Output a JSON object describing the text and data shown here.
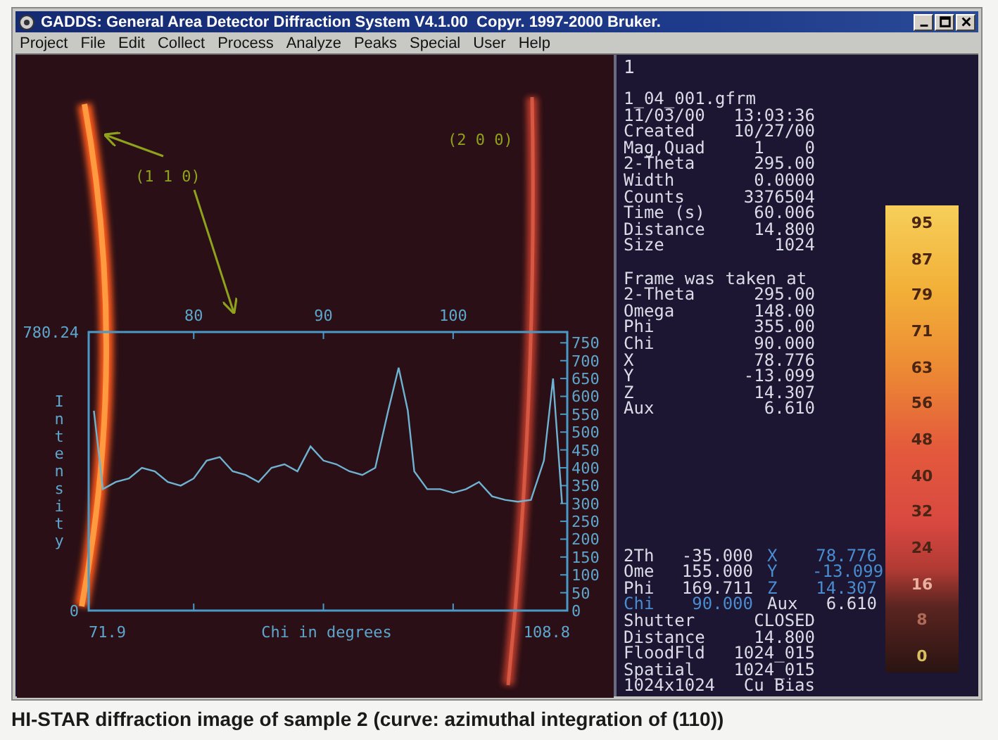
{
  "window": {
    "title": "GADDS: General Area Detector Diffraction System V4.1.00  Copyr. 1997-2000 Bruker."
  },
  "menu": [
    "Project",
    "File",
    "Edit",
    "Collect",
    "Process",
    "Analyze",
    "Peaks",
    "Special",
    "User",
    "Help"
  ],
  "image": {
    "annotations": [
      {
        "text": "(1 1 0)"
      },
      {
        "text": "(2 0 0)"
      }
    ],
    "axis_labels": {
      "y_max": "780.24",
      "y_min": "0",
      "x_min": "71.9",
      "x_max": "108.8"
    },
    "chart_data": {
      "type": "line",
      "xlabel": "Chi in degrees",
      "ylabel": "Intensity",
      "x": [
        72.3,
        73,
        74,
        75,
        76,
        77,
        78,
        79,
        80,
        81,
        82,
        83,
        84,
        85,
        86,
        87,
        88,
        89,
        90,
        91,
        92,
        93,
        94,
        95,
        95.8,
        96.5,
        97,
        98,
        99,
        100,
        101,
        102,
        103,
        104,
        105,
        106,
        107,
        107.7,
        108.4
      ],
      "series": [
        {
          "color": "#6fb3d2",
          "values": [
            560,
            340,
            360,
            370,
            400,
            390,
            360,
            350,
            370,
            420,
            430,
            390,
            380,
            360,
            400,
            410,
            390,
            460,
            420,
            410,
            390,
            380,
            400,
            560,
            680,
            560,
            390,
            340,
            340,
            330,
            340,
            360,
            320,
            310,
            305,
            310,
            420,
            650,
            300
          ]
        }
      ],
      "xlim": [
        71.9,
        108.8
      ],
      "ylim": [
        0,
        780.24
      ],
      "xticks": [
        80,
        90,
        100
      ],
      "yticks": [
        0,
        50,
        100,
        150,
        200,
        250,
        300,
        350,
        400,
        450,
        500,
        550,
        600,
        650,
        700,
        750
      ]
    }
  },
  "info": {
    "header": "1",
    "file": "1_04_001.gfrm",
    "frame_rows": [
      {
        "label": "11/03/00",
        "value": "13:03:36"
      },
      {
        "label": "Created",
        "value": "10/27/00"
      },
      {
        "label": "Mag,Quad",
        "value": "1    0"
      },
      {
        "label": "2-Theta",
        "value": "295.00"
      },
      {
        "label": "Width",
        "value": "0.0000"
      },
      {
        "label": "Counts",
        "value": "3376504"
      },
      {
        "label": "Time (s)",
        "value": "60.006"
      },
      {
        "label": "Distance",
        "value": "14.800"
      },
      {
        "label": "Size",
        "value": "1024"
      }
    ],
    "taken_heading": "Frame was taken at",
    "taken_rows": [
      {
        "label": "2-Theta",
        "value": "295.00"
      },
      {
        "label": "Omega",
        "value": "148.00"
      },
      {
        "label": "Phi",
        "value": "355.00"
      },
      {
        "label": "Chi",
        "value": "90.000"
      },
      {
        "label": "X",
        "value": "78.776"
      },
      {
        "label": "Y",
        "value": "-13.099"
      },
      {
        "label": "Z",
        "value": "14.307"
      },
      {
        "label": "Aux",
        "value": "6.610"
      }
    ],
    "position_rows": [
      [
        {
          "text": "2Th",
          "highlighted": false
        },
        {
          "text": "-35.000",
          "highlighted": false
        },
        {
          "text": "X",
          "highlighted": true
        },
        {
          "text": "78.776",
          "highlighted": true
        }
      ],
      [
        {
          "text": "Ome",
          "highlighted": false
        },
        {
          "text": "155.000",
          "highlighted": false
        },
        {
          "text": "Y",
          "highlighted": true
        },
        {
          "text": "-13.099",
          "highlighted": true
        }
      ],
      [
        {
          "text": "Phi",
          "highlighted": false
        },
        {
          "text": "169.711",
          "highlighted": false
        },
        {
          "text": "Z",
          "highlighted": true
        },
        {
          "text": "14.307",
          "highlighted": true
        }
      ],
      [
        {
          "text": "Chi",
          "highlighted": true
        },
        {
          "text": "90.000",
          "highlighted": true
        },
        {
          "text": "Aux",
          "highlighted": false
        },
        {
          "text": "6.610",
          "highlighted": false
        }
      ]
    ],
    "status_rows": [
      {
        "label": "Shutter",
        "value": "CLOSED"
      },
      {
        "label": "Distance",
        "value": "14.800"
      },
      {
        "label": "FloodFld",
        "value": "1024_015"
      },
      {
        "label": "Spatial",
        "value": "1024_015"
      },
      {
        "label": "1024x1024",
        "value": "Cu Bias"
      }
    ]
  },
  "color_scale": {
    "labels": [
      "95",
      "87",
      "79",
      "71",
      "63",
      "56",
      "48",
      "40",
      "32",
      "24",
      "16",
      "8",
      "0"
    ]
  },
  "caption": "HI-STAR diffraction image of sample 2 (curve: azimuthal integration of (110))"
}
